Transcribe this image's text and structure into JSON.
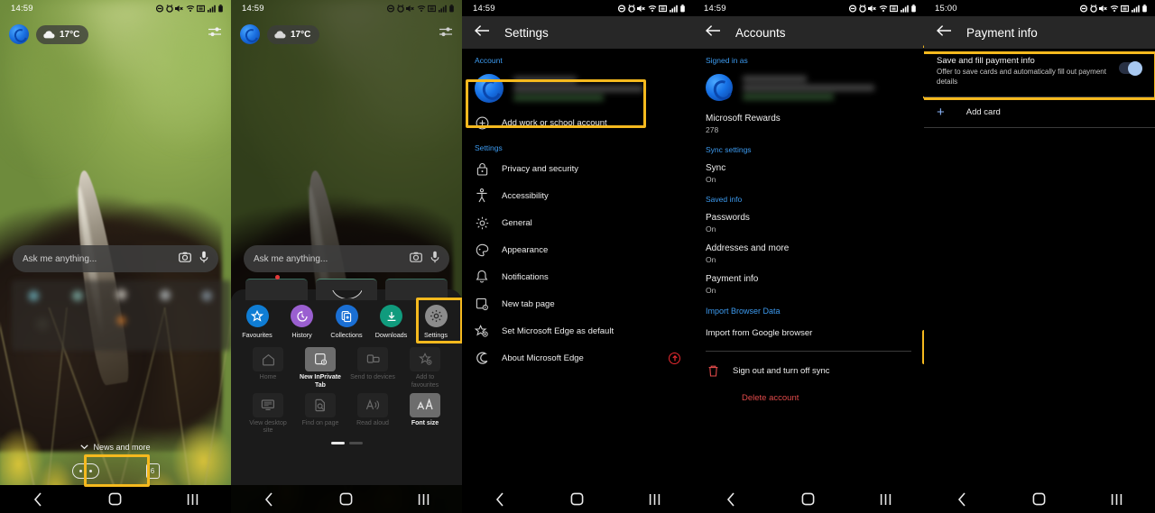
{
  "panels": [
    {
      "id": "edge-home",
      "statusbar": {
        "time": "14:59"
      },
      "weather": {
        "temp": "17°C"
      },
      "search": {
        "placeholder": "Ask me anything..."
      },
      "news_label": "News and more",
      "tab_count": "6"
    },
    {
      "id": "edge-menu",
      "statusbar": {
        "time": "14:59"
      },
      "weather": {
        "temp": "17°C"
      },
      "search": {
        "placeholder": "Ask me anything..."
      },
      "quick_actions": [
        {
          "label": "Favourites",
          "icon": "star-icon",
          "color": "#0f7dd4"
        },
        {
          "label": "History",
          "icon": "history-clock-icon",
          "color": "#9a5fd0"
        },
        {
          "label": "Collections",
          "icon": "collections-add-icon",
          "color": "#1a6fd4"
        },
        {
          "label": "Downloads",
          "icon": "download-arrow-icon",
          "color": "#109b7d"
        },
        {
          "label": "Settings",
          "icon": "gear-icon",
          "color": "#8c8c8c"
        }
      ],
      "menu_grid": [
        {
          "label": "Home",
          "icon": "home-icon",
          "enabled": false
        },
        {
          "label": "New InPrivate Tab",
          "icon": "inprivate-tab-icon",
          "enabled": true
        },
        {
          "label": "Send to devices",
          "icon": "send-to-devices-icon",
          "enabled": false
        },
        {
          "label": "Add to favourites",
          "icon": "star-plus-icon",
          "enabled": false
        },
        {
          "label": "View desktop site",
          "icon": "desktop-monitor-icon",
          "enabled": false
        },
        {
          "label": "Find on page",
          "icon": "find-page-icon",
          "enabled": false
        },
        {
          "label": "Read aloud",
          "icon": "read-aloud-icon",
          "enabled": false
        },
        {
          "label": "Font size",
          "icon": "font-size-icon",
          "enabled": true
        }
      ]
    },
    {
      "id": "settings",
      "statusbar": {
        "time": "14:59"
      },
      "appbar": {
        "title": "Settings",
        "back_icon": "back-arrow-icon"
      },
      "account_section": {
        "header": "Account",
        "add_account_label": "Add work or school account",
        "add_icon": "plus-circle-icon"
      },
      "settings_section": {
        "header": "Settings",
        "items": [
          {
            "label": "Privacy and security",
            "icon": "lock-icon"
          },
          {
            "label": "Accessibility",
            "icon": "accessibility-icon"
          },
          {
            "label": "General",
            "icon": "gear-icon"
          },
          {
            "label": "Appearance",
            "icon": "appearance-icon"
          },
          {
            "label": "Notifications",
            "icon": "bell-icon"
          },
          {
            "label": "New tab page",
            "icon": "new-tab-page-icon"
          },
          {
            "label": "Set Microsoft Edge as default",
            "icon": "star-gear-icon"
          },
          {
            "label": "About Microsoft Edge",
            "icon": "edge-logo-icon",
            "badge": "update-available-icon"
          }
        ]
      }
    },
    {
      "id": "accounts",
      "statusbar": {
        "time": "14:59"
      },
      "appbar": {
        "title": "Accounts",
        "back_icon": "back-arrow-icon"
      },
      "signed_in_header": "Signed in as",
      "rewards": {
        "label": "Microsoft Rewards",
        "value": "278"
      },
      "sync_header": "Sync settings",
      "sync": {
        "label": "Sync",
        "value": "On"
      },
      "saved_header": "Saved info",
      "saved_items": [
        {
          "label": "Passwords",
          "value": "On"
        },
        {
          "label": "Addresses and more",
          "value": "On"
        },
        {
          "label": "Payment info",
          "value": "On",
          "highlighted": true
        }
      ],
      "import_header": "Import Browser Data",
      "import_row": "Import from Google browser",
      "signout_row": {
        "label": "Sign out and turn off sync",
        "icon": "trash-icon"
      },
      "delete_row": "Delete account"
    },
    {
      "id": "payment-info",
      "statusbar": {
        "time": "15:00"
      },
      "appbar": {
        "title": "Payment info",
        "back_icon": "back-arrow-icon"
      },
      "toggle": {
        "title": "Save and fill payment info",
        "subtitle": "Offer to save cards and automatically fill out payment details",
        "state": "on"
      },
      "add_card": {
        "label": "Add card",
        "icon": "plus-icon"
      }
    }
  ],
  "navbar": {
    "back": "back-chevron-icon",
    "home": "home-square-icon",
    "recents": "recents-bars-icon"
  },
  "status_icons": [
    "do-not-disturb-icon",
    "alarm-icon",
    "mute-icon",
    "wifi-icon",
    "nfc-icon",
    "signal-bars-icon",
    "battery-icon"
  ],
  "theme": {
    "highlight": "#F5B91E",
    "accent_blue": "#3d9bf0",
    "danger_red": "#e04a4a",
    "toggle_thumb": "#a8c8f0"
  }
}
